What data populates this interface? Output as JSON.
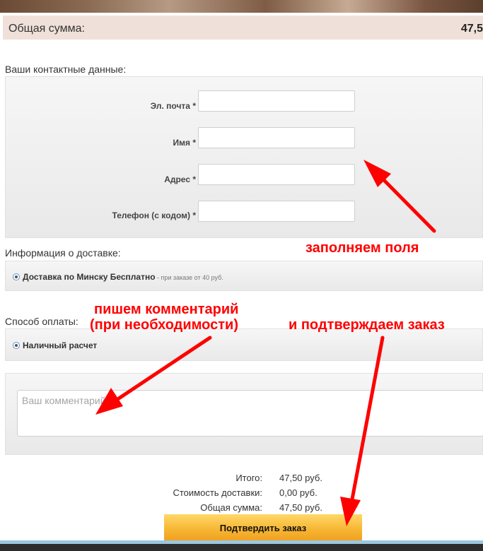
{
  "summary": {
    "total_label": "Общая сумма:",
    "total_value": "47,5"
  },
  "contact": {
    "title": "Ваши контактные данные:",
    "email_label": "Эл. почта *",
    "name_label": "Имя *",
    "address_label": "Адрес *",
    "phone_label": "Телефон (с кодом) *",
    "email_value": "",
    "name_value": "",
    "address_value": "",
    "phone_value": ""
  },
  "delivery": {
    "title": "Информация о доставке:",
    "option_label": "Доставка по Минску Бесплатно",
    "option_note": " - при заказе от 40 руб."
  },
  "payment": {
    "title": "Способ оплаты:",
    "option_label": "Наличный расчет"
  },
  "comment": {
    "placeholder": "Ваш комментарий"
  },
  "totals": {
    "subtotal_label": "Итого:",
    "subtotal_value": "47,50 руб.",
    "delivery_label": "Стоимость доставки:",
    "delivery_value": "0,00 руб.",
    "grand_label": "Общая сумма:",
    "grand_value": "47,50 руб."
  },
  "confirm_button": "Подтвердить заказ",
  "annotations": {
    "fill_fields": "заполняем поля",
    "comment_line1": "пишем комментарий",
    "comment_line2": "(при необходимости)",
    "confirm": "и подтверждаем заказ"
  },
  "colors": {
    "annotation": "#ff0000",
    "button_top": "#ffd86a",
    "button_bottom": "#f0a020",
    "total_bar": "#efe1d9"
  }
}
